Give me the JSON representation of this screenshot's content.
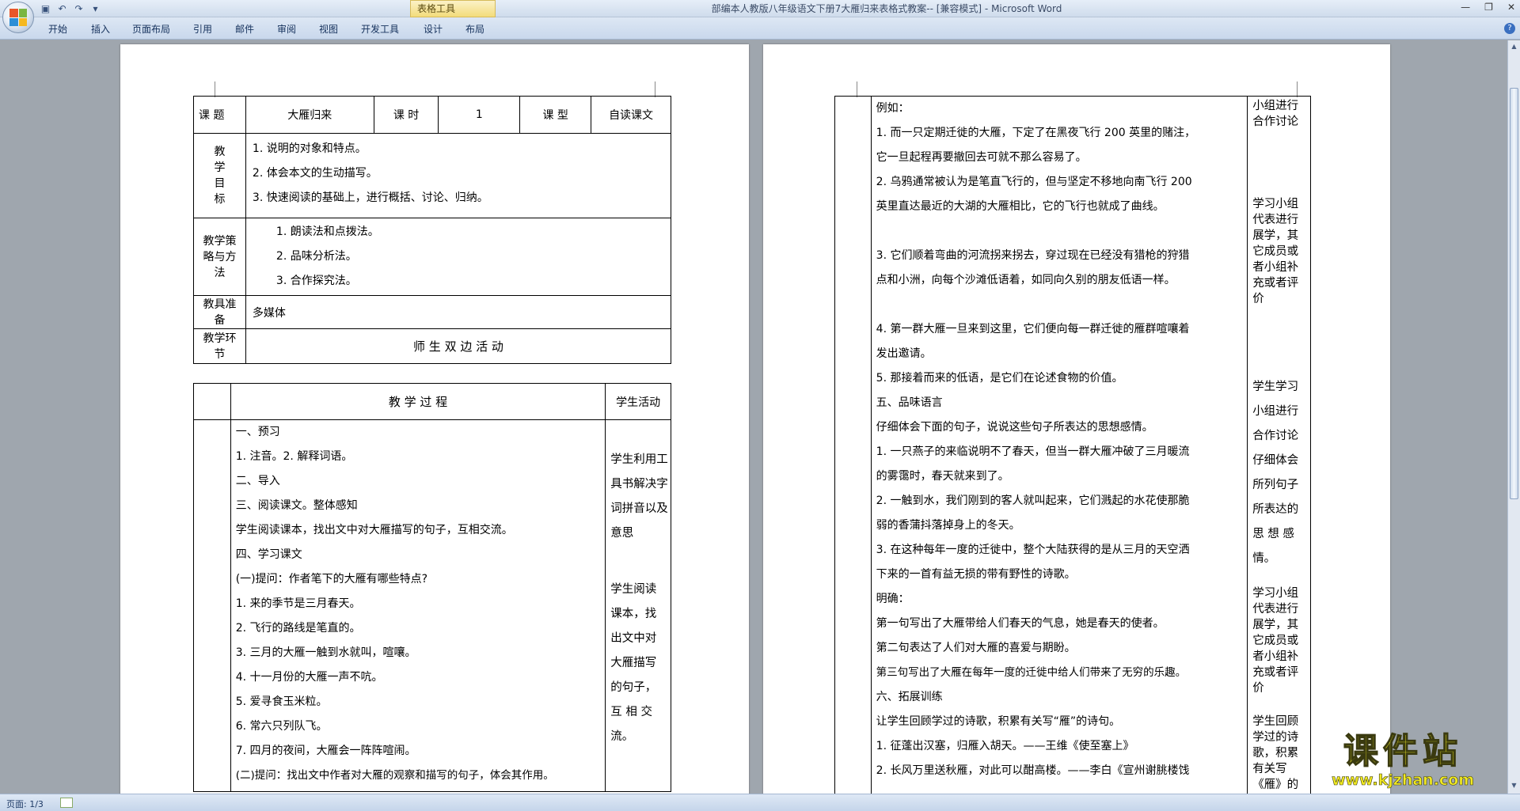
{
  "app": {
    "window_title": "部编本人教版八年级语文下册7大雁归来表格式教案-- [兼容模式] - Microsoft Word",
    "contextual_tab_group": "表格工具"
  },
  "quick_access": {
    "save": "save-icon",
    "undo": "undo-icon",
    "redo": "redo-icon",
    "customize": "▾"
  },
  "ribbon": {
    "tabs": [
      "开始",
      "插入",
      "页面布局",
      "引用",
      "邮件",
      "审阅",
      "视图",
      "开发工具",
      "设计",
      "布局"
    ]
  },
  "left_page": {
    "header_row": {
      "c1": "课  题",
      "c2": "大雁归来",
      "c3": "课 时",
      "c4": "1",
      "c5": "课 型",
      "c6": "自读课文"
    },
    "goals_label": [
      "教",
      "学",
      "目",
      "标"
    ],
    "goals": [
      "1. 说明的对象和特点。",
      "2. 体会本文的生动描写。",
      "3. 快速阅读的基础上，进行概括、讨论、归纳。"
    ],
    "strategy_label": [
      "教学策",
      "略与方",
      "法"
    ],
    "strategies": [
      "1. 朗读法和点拨法。",
      "2. 品味分析法。",
      "3. 合作探究法。"
    ],
    "tools_label": [
      "教具准",
      "备"
    ],
    "tools": "多媒体",
    "stage_label": [
      "教学环",
      "节"
    ],
    "stage_content": "师  生  双  边  活  动",
    "process_header": "教 学 过 程",
    "student_header": "学生活动",
    "process_lines": [
      "一、预习",
      "1. 注音。2. 解释词语。",
      "二、导入",
      "三、阅读课文。整体感知",
      "学生阅读课本，找出文中对大雁描写的句子，互相交流。",
      "四、学习课文",
      "(一)提问：作者笔下的大雁有哪些特点?",
      "1. 来的季节是三月春天。",
      "2. 飞行的路线是笔直的。",
      "3. 三月的大雁一触到水就叫，喧嚷。",
      "4. 十一月份的大雁一声不吭。",
      "5. 爱寻食玉米粒。",
      "6. 常六只列队飞。",
      "7. 四月的夜间，大雁会一阵阵喧闹。",
      "(二)提问：找出文中作者对大雁的观察和描写的句子，体会其作用。"
    ],
    "student_lines": [
      "学生利用工",
      "具书解决字",
      "词拼音以及",
      "意思",
      "",
      "",
      "学生阅读",
      "课本，找",
      "出文中对",
      "大雁描写",
      "的句子，",
      "互 相 交",
      "流。"
    ]
  },
  "right_page": {
    "process_lines": [
      "例如：",
      "1. 而一只定期迁徙的大雁，下定了在黑夜飞行 200 英里的赌注，",
      "它一旦起程再要撤回去可就不那么容易了。",
      "2. 乌鸦通常被认为是笔直飞行的，但与坚定不移地向南飞行 200",
      "英里直达最近的大湖的大雁相比，它的飞行也就成了曲线。",
      "",
      "3. 它们顺着弯曲的河流拐来拐去，穿过现在已经没有猎枪的狩猎",
      "点和小洲，向每个沙滩低语着，如同向久别的朋友低语一样。",
      "",
      "4. 第一群大雁一旦来到这里，它们便向每一群迁徙的雁群喧嚷着",
      "发出邀请。",
      "5. 那接着而来的低语，是它们在论述食物的价值。",
      "五、品味语言",
      "仔细体会下面的句子，说说这些句子所表达的思想感情。",
      "1. 一只燕子的来临说明不了春天，但当一群大雁冲破了三月暖流",
      "的雾霭时，春天就来到了。",
      "2. 一触到水，我们刚到的客人就叫起来，它们溅起的水花使那脆",
      "弱的香蒲抖落掉身上的冬天。",
      "3. 在这种每年一度的迁徙中，整个大陆获得的是从三月的天空洒",
      "下来的一首有益无损的带有野性的诗歌。",
      "明确：",
      "第一句写出了大雁带给人们春天的气息，她是春天的使者。",
      "第二句表达了人们对大雁的喜爱与期盼。",
      "第三句写出了大雁在每年一度的迁徙中给人们带来了无穷的乐趣。",
      "六、拓展训练",
      "让学生回顾学过的诗歌，积累有关写“雁”的诗句。",
      "1. 征蓬出汉塞，归雁入胡天。——王维《使至塞上》",
      "2. 长风万里送秋雁，对此可以酣高楼。——李白《宣州谢朓楼饯"
    ],
    "student_blocks": [
      {
        "lines": [
          "小组进行",
          "合作讨论"
        ]
      },
      {
        "lines": [
          "学习小组",
          "代表进行",
          "展学，其",
          "它成员或",
          "者小组补",
          "充或者评",
          "价"
        ]
      },
      {
        "lines": [
          "学生学习",
          "小组进行",
          "合作讨论",
          "仔细体会",
          "所列句子",
          "所表达的",
          "思 想 感",
          "情。"
        ]
      },
      {
        "lines": [
          "学习小组",
          "代表进行",
          "展学，其",
          "它成员或",
          "者小组补",
          "充或者评",
          "价"
        ]
      },
      {
        "lines": [
          "学生回顾",
          "学过的诗",
          "歌，积累",
          "有关写",
          "《雁》的"
        ]
      }
    ]
  },
  "status": {
    "page": "页面: 1/3"
  },
  "watermark": {
    "big": "课件站",
    "small": "www.kjzhan.com"
  }
}
